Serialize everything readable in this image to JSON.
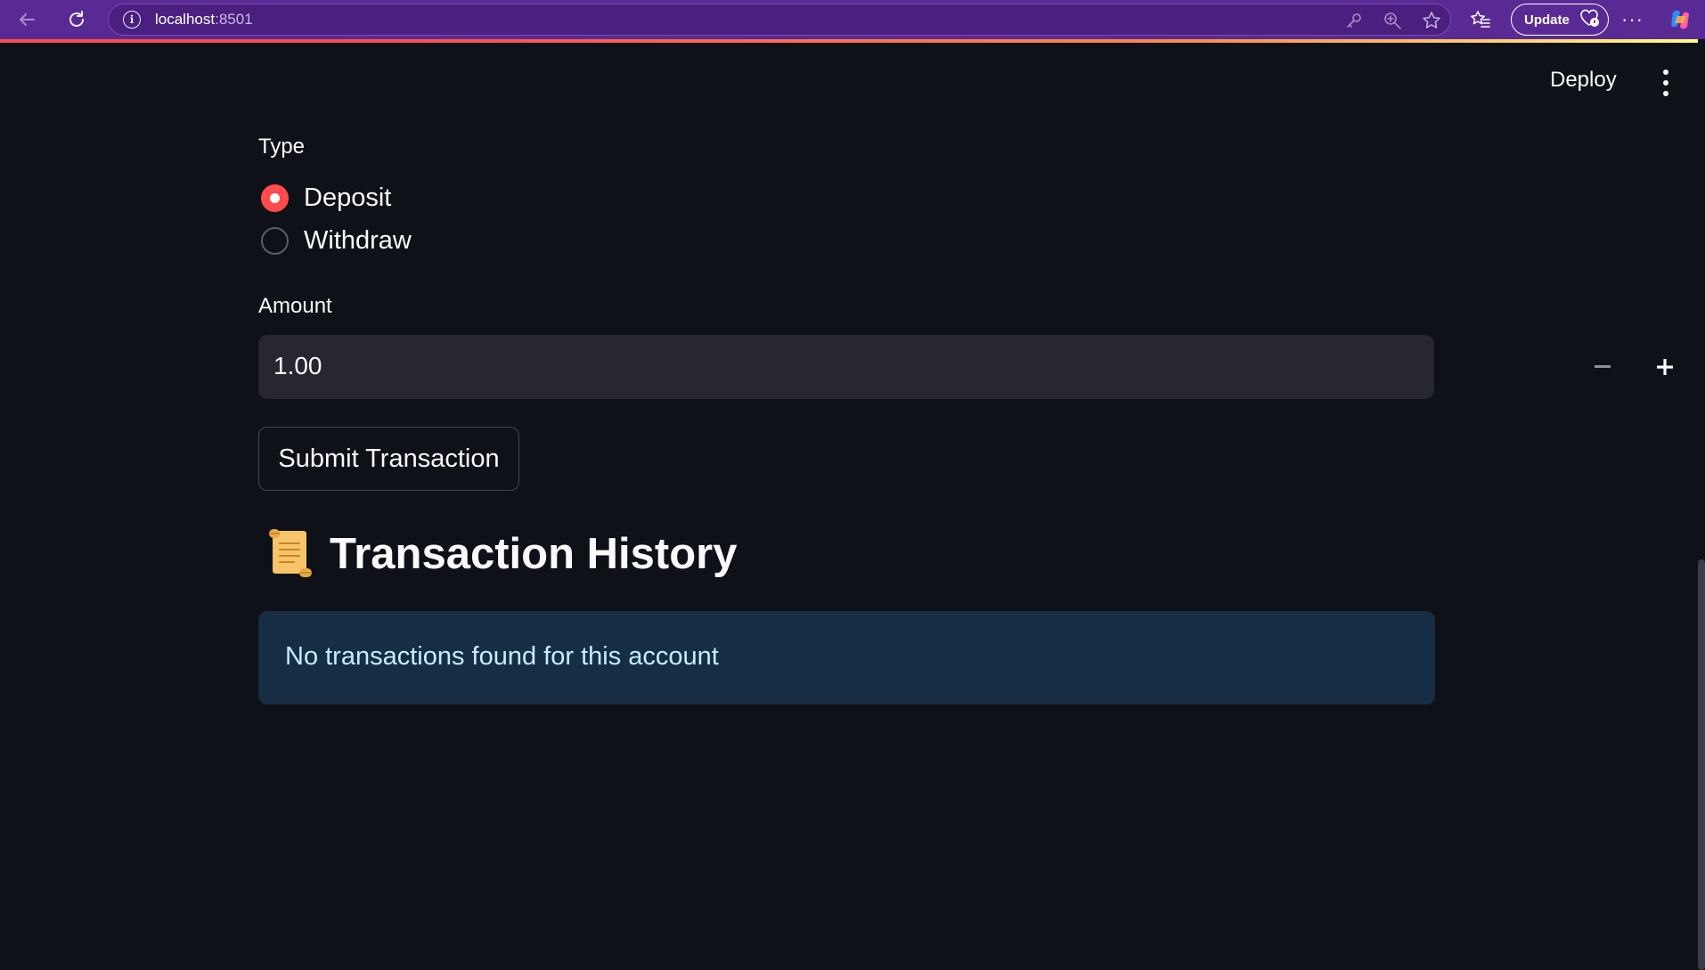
{
  "browser": {
    "url_host": "localhost",
    "url_port": ":8501",
    "update_label": "Update"
  },
  "header": {
    "deploy_label": "Deploy"
  },
  "form": {
    "type_label": "Type",
    "type_options": [
      "Deposit",
      "Withdraw"
    ],
    "selected_type": "Deposit",
    "amount_label": "Amount",
    "amount_value": "1.00",
    "submit_label": "Submit Transaction"
  },
  "history": {
    "title": "Transaction History",
    "empty_message": "No transactions found for this account"
  },
  "colors": {
    "browser_chrome": "#5a2a94",
    "app_background": "#0e1117",
    "primary_accent": "#ff4b4b",
    "input_background": "#262730",
    "info_background": "#172d43",
    "info_text": "#c7ebff"
  },
  "icons": {
    "back": "back-arrow-icon",
    "reload": "reload-icon",
    "site_info": "info-icon",
    "password": "key-icon",
    "zoom": "zoom-icon",
    "favorite": "star-icon",
    "favorites_bar": "favorites-icon",
    "more": "more-icon",
    "copilot": "copilot-icon",
    "menu": "kebab-menu-icon",
    "history": "scroll-icon"
  }
}
